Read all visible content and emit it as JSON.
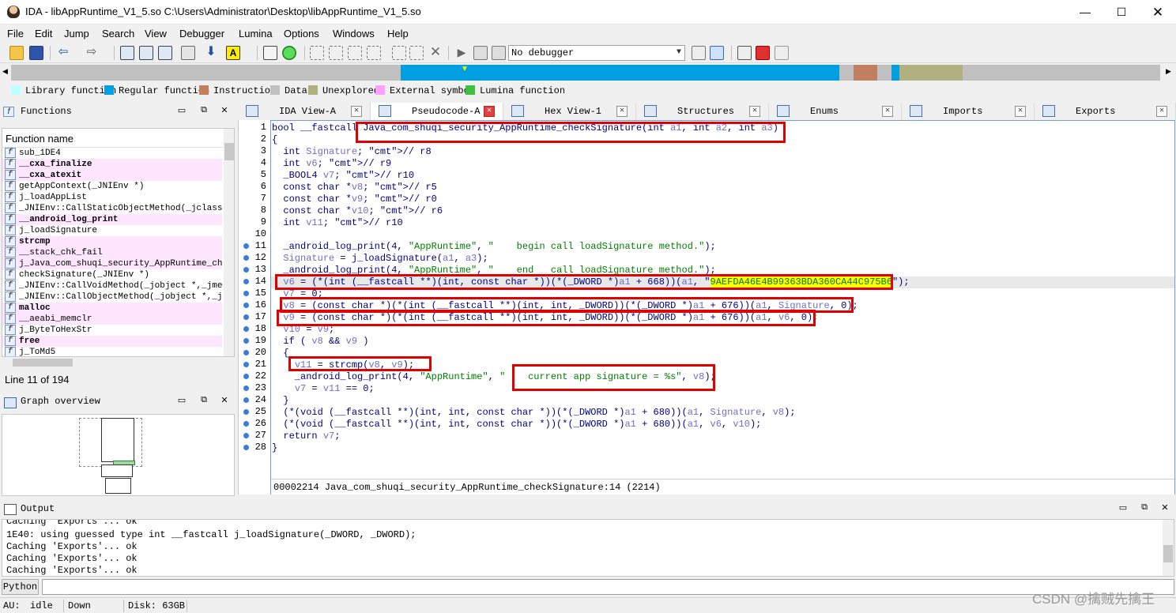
{
  "window": {
    "title": "IDA - libAppRuntime_V1_5.so C:\\Users\\Administrator\\Desktop\\libAppRuntime_V1_5.so",
    "minimize": "—",
    "maximize": "☐",
    "close": "✕"
  },
  "menu": [
    "File",
    "Edit",
    "Jump",
    "Search",
    "View",
    "Debugger",
    "Lumina",
    "Options",
    "Windows",
    "Help"
  ],
  "toolbar": {
    "debugger": "No debugger"
  },
  "legend": [
    {
      "label": "Library function",
      "color": "#c0ffff"
    },
    {
      "label": "Regular function",
      "color": "#00a0e0"
    },
    {
      "label": "Instruction",
      "color": "#c08060"
    },
    {
      "label": "Data",
      "color": "#c0c0c0"
    },
    {
      "label": "Unexplored",
      "color": "#b0b080"
    },
    {
      "label": "External symbol",
      "color": "#ffa0ff"
    },
    {
      "label": "Lumina function",
      "color": "#40c040"
    }
  ],
  "functions_panel": {
    "title": "Functions",
    "column": "Function name",
    "items": [
      {
        "name": "sub_1DE4",
        "style": "normal"
      },
      {
        "name": "__cxa_finalize",
        "style": "lib-bold"
      },
      {
        "name": "__cxa_atexit",
        "style": "lib-bold"
      },
      {
        "name": "getAppContext(_JNIEnv *)",
        "style": "normal"
      },
      {
        "name": "j_loadAppList",
        "style": "normal"
      },
      {
        "name": "_JNIEnv::CallStaticObjectMethod(_jclass *,",
        "style": "normal"
      },
      {
        "name": "__android_log_print",
        "style": "lib-bold"
      },
      {
        "name": "j_loadSignature",
        "style": "normal"
      },
      {
        "name": "strcmp",
        "style": "lib-bold"
      },
      {
        "name": "__stack_chk_fail",
        "style": "lib"
      },
      {
        "name": "j_Java_com_shuqi_security_AppRuntime_check",
        "style": "sel"
      },
      {
        "name": "checkSignature(_JNIEnv *)",
        "style": "normal"
      },
      {
        "name": "_JNIEnv::CallVoidMethod(_jobject *,_jmetho",
        "style": "normal"
      },
      {
        "name": "_JNIEnv::CallObjectMethod(_jobject *,_jmet",
        "style": "normal"
      },
      {
        "name": "malloc",
        "style": "lib-bold"
      },
      {
        "name": "__aeabi_memclr",
        "style": "lib"
      },
      {
        "name": "j_ByteToHexStr",
        "style": "normal"
      },
      {
        "name": "free",
        "style": "lib-bold"
      },
      {
        "name": "j_ToMd5",
        "style": "normal"
      }
    ],
    "status": "Line 11 of 194"
  },
  "graph_panel": {
    "title": "Graph overview"
  },
  "tabs": [
    {
      "label": "IDA View-A",
      "active": false
    },
    {
      "label": "Pseudocode-A",
      "active": true
    },
    {
      "label": "Hex View-1",
      "active": false
    },
    {
      "label": "Structures",
      "active": false
    },
    {
      "label": "Enums",
      "active": false
    },
    {
      "label": "Imports",
      "active": false
    },
    {
      "label": "Exports",
      "active": false
    }
  ],
  "code": {
    "line_numbers": [
      "1",
      "2",
      "3",
      "4",
      "5",
      "6",
      "7",
      "8",
      "9",
      "10",
      "11",
      "12",
      "13",
      "14",
      "15",
      "16",
      "17",
      "18",
      "19",
      "20",
      "21",
      "22",
      "23",
      "24",
      "25",
      "26",
      "27",
      "28"
    ],
    "lines": [
      "bool __fastcall Java_com_shuqi_security_AppRuntime_checkSignature(int a1, int a2, int a3)",
      "{",
      "  int Signature; // r8",
      "  int v6; // r9",
      "  _BOOL4 v7; // r10",
      "  const char *v8; // r5",
      "  const char *v9; // r0",
      "  const char *v10; // r6",
      "  int v11; // r10",
      "",
      "  _android_log_print(4, \"AppRuntime\", \"    begin call loadSignature method.\");",
      "  Signature = j_loadSignature(a1, a3);",
      "  _android_log_print(4, \"AppRuntime\", \"    end   call loadSignature method.\");",
      "  v6 = (*(int (__fastcall **)(int, const char *))(*(_DWORD *)a1 + 668))(a1, \"9AEFDA46E4B99363BDA360CA44C975B6\");",
      "  v7 = 0;",
      "  v8 = (const char *)(*(int (__fastcall **)(int, int, _DWORD))(*(_DWORD *)a1 + 676))(a1, Signature, 0);",
      "  v9 = (const char *)(*(int (__fastcall **)(int, int, _DWORD))(*(_DWORD *)a1 + 676))(a1, v6, 0);",
      "  v10 = v9;",
      "  if ( v8 && v9 )",
      "  {",
      "    v11 = strcmp(v8, v9);",
      "    _android_log_print(4, \"AppRuntime\", \"    current app signature = %s\", v8);",
      "    v7 = v11 == 0;",
      "  }",
      "  (*(void (__fastcall **)(int, int, const char *))(*(_DWORD *)a1 + 680))(a1, Signature, v8);",
      "  (*(void (__fastcall **)(int, int, const char *))(*(_DWORD *)a1 + 680))(a1, v6, v10);",
      "  return v7;",
      "}"
    ],
    "status": "00002214 Java_com_shuqi_security_AppRuntime_checkSignature:14 (2214)"
  },
  "output": {
    "title": "Output",
    "lines": [
      "Caching 'Exports'... ok",
      "1E40: using guessed type int __fastcall j_loadSignature(_DWORD, _DWORD);",
      "Caching 'Exports'... ok",
      "Caching 'Exports'... ok",
      "Caching 'Exports'... ok"
    ],
    "python_label": "Python"
  },
  "statusbar": {
    "au_label": "AU:",
    "au_value": "idle",
    "direction": "Down",
    "disk": "Disk: 63GB"
  },
  "watermark": "CSDN @擒贼先擒王"
}
